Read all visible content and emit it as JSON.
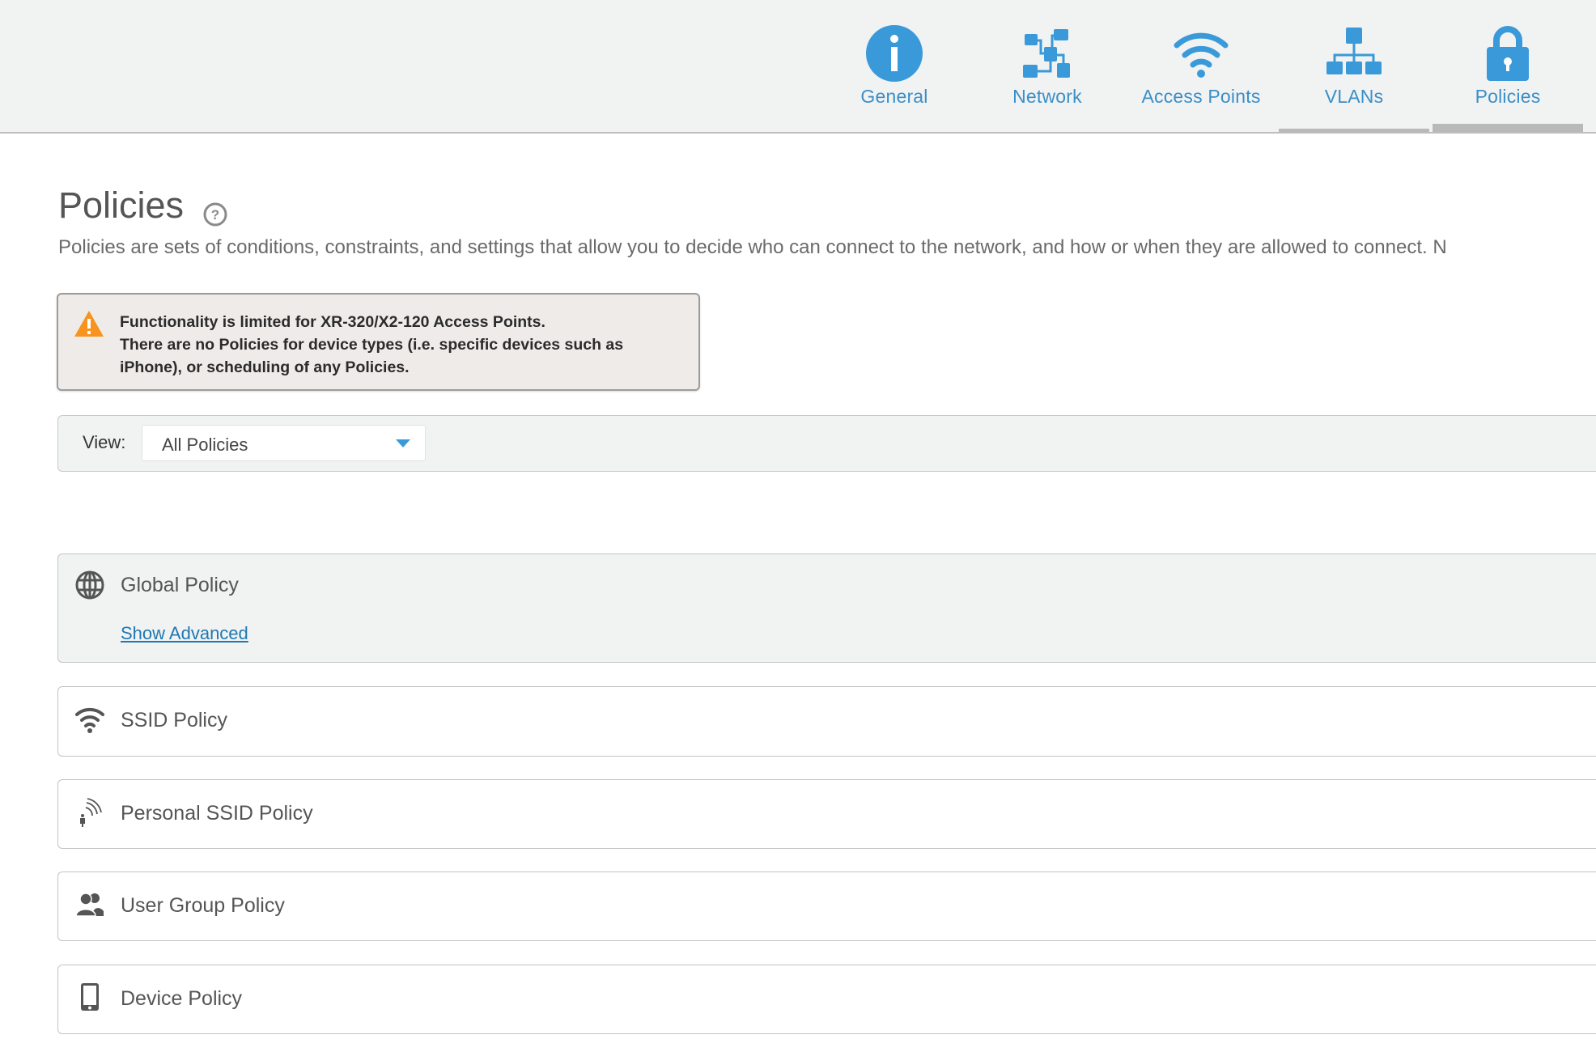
{
  "header": {
    "tabs": [
      {
        "label": "General",
        "icon": "info-icon",
        "state": "normal"
      },
      {
        "label": "Network",
        "icon": "network-icon",
        "state": "normal"
      },
      {
        "label": "Access Points",
        "icon": "wifi-icon",
        "state": "normal"
      },
      {
        "label": "VLANs",
        "icon": "vlan-hierarchy-icon",
        "state": "hover"
      },
      {
        "label": "Policies",
        "icon": "lock-icon",
        "state": "active"
      }
    ],
    "accent_color": "#3a9ad9"
  },
  "page": {
    "title": "Policies",
    "help_icon": "question-circle-icon",
    "description": "Policies are sets of conditions, constraints, and settings that allow you to decide who can connect to the network, and how or when they are allowed to connect. N"
  },
  "alert": {
    "icon": "warning-triangle-icon",
    "lines": [
      "Functionality is limited for XR-320/X2-120 Access Points.",
      "There are no Policies for device types (i.e. specific devices such as",
      "iPhone), or scheduling of any Policies."
    ]
  },
  "view_filter": {
    "label": "View:",
    "selected": "All Policies"
  },
  "policies": [
    {
      "label": "Global Policy",
      "icon": "globe-icon",
      "link": "Show Advanced"
    },
    {
      "label": "SSID Policy",
      "icon": "wifi-icon"
    },
    {
      "label": "Personal SSID Policy",
      "icon": "personal-ssid-icon"
    },
    {
      "label": "User Group Policy",
      "icon": "users-icon"
    },
    {
      "label": "Device Policy",
      "icon": "mobile-device-icon"
    }
  ]
}
